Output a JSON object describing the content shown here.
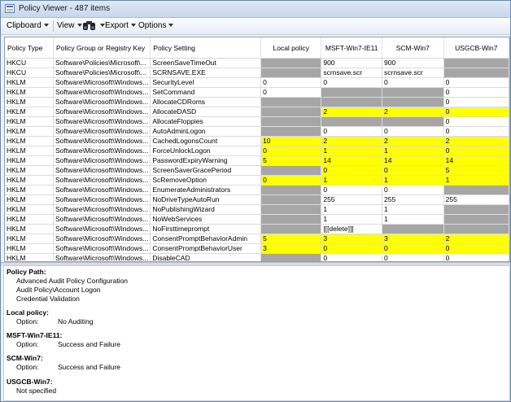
{
  "window": {
    "title": "Policy Viewer - 487 items"
  },
  "toolbar": {
    "clipboard": "Clipboard",
    "view": "View",
    "export": "Export",
    "options": "Options"
  },
  "columns": [
    "Policy Type",
    "Policy Group or Registry Key",
    "Policy Setting",
    "Local policy",
    "MSFT-Win7-IE11",
    "SCM-Win7",
    "USGCB-Win7"
  ],
  "rows": [
    {
      "type": "HKCU",
      "key": "Software\\Policies\\Microsoft\\...",
      "setting": "ScreenSaveTimeOut",
      "values": [
        "",
        "900",
        "900",
        ""
      ],
      "fills": [
        "gray",
        "",
        "",
        "gray"
      ]
    },
    {
      "type": "HKCU",
      "key": "Software\\Policies\\Microsoft\\...",
      "setting": "SCRNSAVE.EXE",
      "values": [
        "",
        "scrnsave.scr",
        "scrnsave.scr",
        ""
      ],
      "fills": [
        "gray",
        "",
        "",
        "gray"
      ]
    },
    {
      "type": "HKLM",
      "key": "Software\\Microsoft\\Windows...",
      "setting": "SecurityLevel",
      "values": [
        "0",
        "0",
        "0",
        "0"
      ],
      "fills": [
        "",
        "",
        "",
        ""
      ]
    },
    {
      "type": "HKLM",
      "key": "Software\\Microsoft\\Windows...",
      "setting": "SetCommand",
      "values": [
        "0",
        "",
        "",
        "0"
      ],
      "fills": [
        "",
        "gray",
        "gray",
        ""
      ]
    },
    {
      "type": "HKLM",
      "key": "Software\\Microsoft\\Windows...",
      "setting": "AllocateCDRoms",
      "values": [
        "",
        "",
        "",
        "0"
      ],
      "fills": [
        "gray",
        "gray",
        "gray",
        ""
      ]
    },
    {
      "type": "HKLM",
      "key": "Software\\Microsoft\\Windows...",
      "setting": "AllocateDASD",
      "values": [
        "",
        "2",
        "2",
        "0"
      ],
      "fills": [
        "gray",
        "yellow",
        "yellow",
        "yellow"
      ]
    },
    {
      "type": "HKLM",
      "key": "Software\\Microsoft\\Windows...",
      "setting": "AllocateFloppies",
      "values": [
        "",
        "",
        "",
        "0"
      ],
      "fills": [
        "gray",
        "gray",
        "gray",
        ""
      ]
    },
    {
      "type": "HKLM",
      "key": "Software\\Microsoft\\Windows...",
      "setting": "AutoAdminLogon",
      "values": [
        "",
        "0",
        "0",
        "0"
      ],
      "fills": [
        "gray",
        "",
        "",
        ""
      ]
    },
    {
      "type": "HKLM",
      "key": "Software\\Microsoft\\Windows...",
      "setting": "CachedLogonsCount",
      "values": [
        "10",
        "2",
        "2",
        "2"
      ],
      "fills": [
        "yellow",
        "yellow",
        "yellow",
        "yellow"
      ]
    },
    {
      "type": "HKLM",
      "key": "Software\\Microsoft\\Windows...",
      "setting": "ForceUnlockLogon",
      "values": [
        "0",
        "1",
        "1",
        "0"
      ],
      "fills": [
        "yellow",
        "yellow",
        "yellow",
        "yellow"
      ]
    },
    {
      "type": "HKLM",
      "key": "Software\\Microsoft\\Windows...",
      "setting": "PasswordExpiryWarning",
      "values": [
        "5",
        "14",
        "14",
        "14"
      ],
      "fills": [
        "yellow",
        "yellow",
        "yellow",
        "yellow"
      ]
    },
    {
      "type": "HKLM",
      "key": "Software\\Microsoft\\Windows...",
      "setting": "ScreenSaverGracePeriod",
      "values": [
        "",
        "0",
        "0",
        "5"
      ],
      "fills": [
        "gray",
        "yellow",
        "yellow",
        "yellow"
      ]
    },
    {
      "type": "HKLM",
      "key": "Software\\Microsoft\\Windows...",
      "setting": "ScRemoveOption",
      "values": [
        "0",
        "1",
        "1",
        "1"
      ],
      "fills": [
        "yellow",
        "yellow",
        "yellow",
        "yellow"
      ]
    },
    {
      "type": "HKLM",
      "key": "Software\\Microsoft\\Windows...",
      "setting": "EnumerateAdministrators",
      "values": [
        "",
        "0",
        "0",
        ""
      ],
      "fills": [
        "gray",
        "",
        "",
        "gray"
      ]
    },
    {
      "type": "HKLM",
      "key": "Software\\Microsoft\\Windows...",
      "setting": "NoDriveTypeAutoRun",
      "values": [
        "",
        "255",
        "255",
        "255"
      ],
      "fills": [
        "gray",
        "",
        "",
        ""
      ]
    },
    {
      "type": "HKLM",
      "key": "Software\\Microsoft\\Windows...",
      "setting": "NoPublishingWizard",
      "values": [
        "",
        "1",
        "1",
        ""
      ],
      "fills": [
        "gray",
        "",
        "",
        "gray"
      ]
    },
    {
      "type": "HKLM",
      "key": "Software\\Microsoft\\Windows...",
      "setting": "NoWebServices",
      "values": [
        "",
        "1",
        "1",
        ""
      ],
      "fills": [
        "gray",
        "",
        "",
        "gray"
      ]
    },
    {
      "type": "HKLM",
      "key": "Software\\Microsoft\\Windows...",
      "setting": "NoFirsttimeprompt",
      "values": [
        "",
        "[[[delete]]]",
        "",
        ""
      ],
      "fills": [
        "gray",
        "",
        "gray",
        "gray"
      ]
    },
    {
      "type": "HKLM",
      "key": "Software\\Microsoft\\Windows...",
      "setting": "ConsentPromptBehaviorAdmin",
      "values": [
        "5",
        "3",
        "3",
        "2"
      ],
      "fills": [
        "yellow",
        "yellow",
        "yellow",
        "yellow"
      ]
    },
    {
      "type": "HKLM",
      "key": "Software\\Microsoft\\Windows...",
      "setting": "ConsentPromptBehaviorUser",
      "values": [
        "3",
        "0",
        "0",
        "0"
      ],
      "fills": [
        "yellow",
        "yellow",
        "yellow",
        "yellow"
      ]
    },
    {
      "type": "HKLM",
      "key": "Software\\Microsoft\\Windows...",
      "setting": "DisableCAD",
      "values": [
        "",
        "0",
        "0",
        "0"
      ],
      "fills": [
        "gray",
        "",
        "",
        ""
      ]
    }
  ],
  "details": {
    "policy_path_label": "Policy Path:",
    "policy_path": [
      "Advanced Audit Policy Configuration",
      "Audit Policy\\Account Logon",
      "Credential Validation"
    ],
    "sections": [
      {
        "label": "Local policy:",
        "option_label": "Option:",
        "value": "No Auditing"
      },
      {
        "label": "MSFT-Win7-IE11:",
        "option_label": "Option:",
        "value": "Success and Failure"
      },
      {
        "label": "SCM-Win7:",
        "option_label": "Option:",
        "value": "Success and Failure"
      },
      {
        "label": "USGCB-Win7:",
        "option_label": "",
        "value": "Not specified"
      }
    ]
  },
  "colors": {
    "highlight": "#ffff00",
    "not_present": "#a6a6a6"
  },
  "icons": {
    "app": "app-window-icon",
    "find": "binoculars-icon"
  }
}
